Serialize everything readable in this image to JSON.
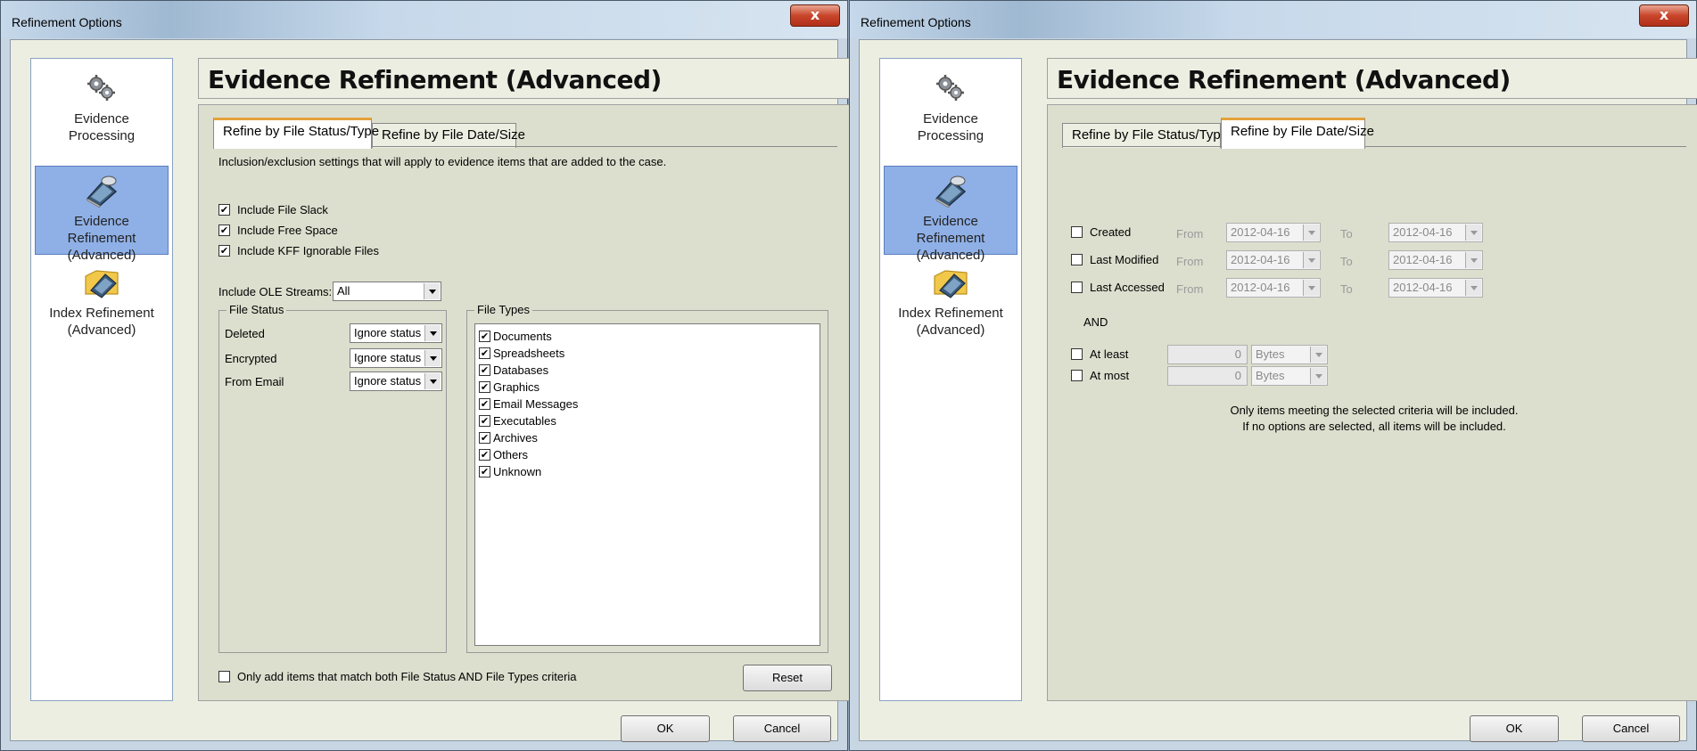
{
  "left": {
    "title": "Refinement Options",
    "header": "Evidence Refinement (Advanced)",
    "nav": [
      {
        "label1": "Evidence",
        "label2": "Processing"
      },
      {
        "label1": "Evidence",
        "label2": "Refinement",
        "label3": "(Advanced)"
      },
      {
        "label1": "Index Refinement",
        "label2": "(Advanced)"
      }
    ],
    "tabs": [
      "Refine by File Status/Type",
      "Refine by File Date/Size"
    ],
    "description": "Inclusion/exclusion settings that will apply to evidence items that are added to the case.",
    "checks": [
      {
        "label": "Include File Slack",
        "checked": true
      },
      {
        "label": "Include Free Space",
        "checked": true
      },
      {
        "label": "Include KFF Ignorable Files",
        "checked": true
      }
    ],
    "ole_label": "Include OLE Streams:",
    "ole_value": "All",
    "file_status": {
      "title": "File Status",
      "rows": [
        {
          "label": "Deleted",
          "value": "Ignore status"
        },
        {
          "label": "Encrypted",
          "value": "Ignore status"
        },
        {
          "label": "From Email",
          "value": "Ignore status"
        }
      ]
    },
    "file_types": {
      "title": "File Types",
      "items": [
        "Documents",
        "Spreadsheets",
        "Databases",
        "Graphics",
        "Email Messages",
        "Executables",
        "Archives",
        "Others",
        "Unknown"
      ]
    },
    "match_both": "Only add items that match both File Status AND File Types criteria",
    "reset": "Reset",
    "ok": "OK",
    "cancel": "Cancel"
  },
  "right": {
    "title": "Refinement Options",
    "header": "Evidence Refinement (Advanced)",
    "tabs": [
      "Refine by File Status/Type",
      "Refine by File Date/Size"
    ],
    "date_rows": [
      {
        "label": "Created",
        "from_label": "From",
        "from": "2012-04-16",
        "to_label": "To",
        "to": "2012-04-16"
      },
      {
        "label": "Last Modified",
        "from_label": "From",
        "from": "2012-04-16",
        "to_label": "To",
        "to": "2012-04-16"
      },
      {
        "label": "Last Accessed",
        "from_label": "From",
        "from": "2012-04-16",
        "to_label": "To",
        "to": "2012-04-16"
      }
    ],
    "and_label": "AND",
    "size_rows": [
      {
        "label": "At least",
        "value": "0",
        "unit": "Bytes"
      },
      {
        "label": "At most",
        "value": "0",
        "unit": "Bytes"
      }
    ],
    "info_line1": "Only items meeting the selected criteria will be included.",
    "info_line2": "If no options are selected, all items will be included.",
    "ok": "OK",
    "cancel": "Cancel"
  }
}
